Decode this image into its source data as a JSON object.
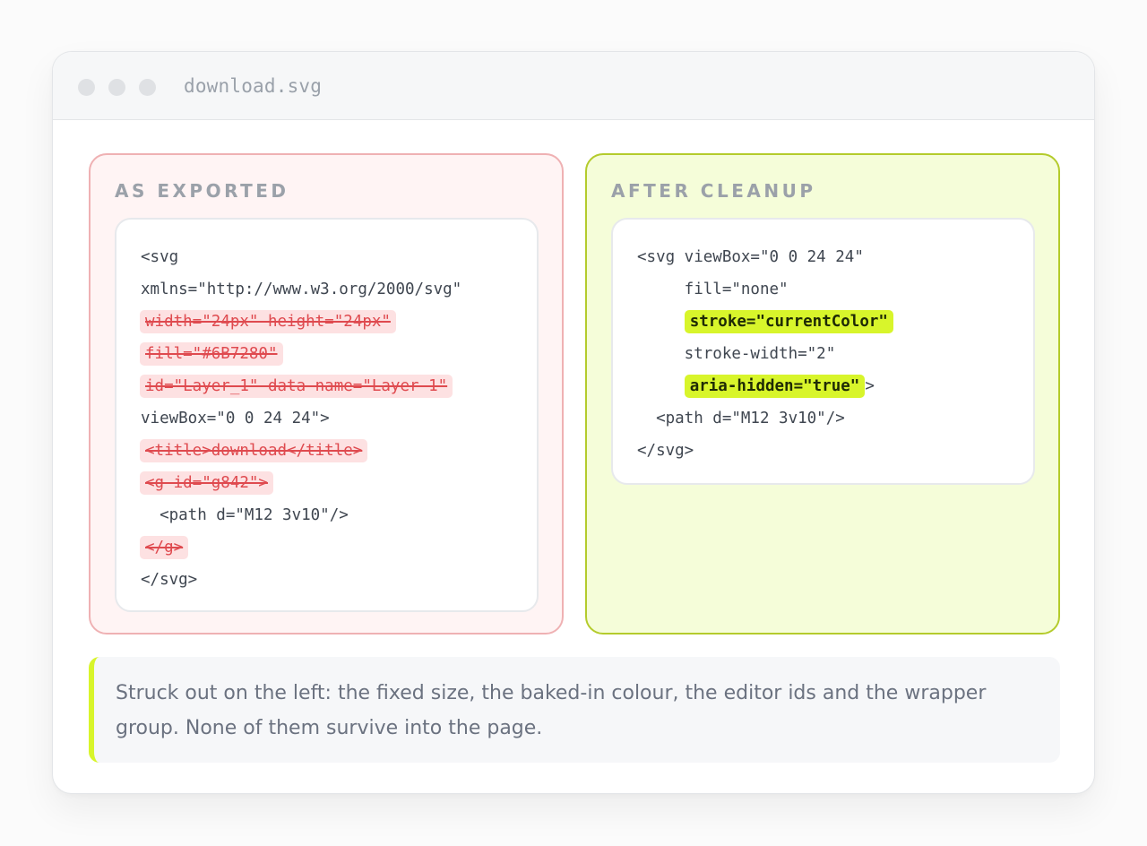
{
  "window": {
    "title": "download.svg"
  },
  "left_panel": {
    "label": "AS EXPORTED",
    "lines": [
      {
        "text": "<svg"
      },
      {
        "text": "xmlns=\"http://www.w3.org/2000/svg\""
      },
      {
        "text": "width=\"24px\" height=\"24px\""
      },
      {
        "text": "fill=\"#6B7280\""
      },
      {
        "text": "id=\"Layer_1\" data-name=\"Layer 1\""
      },
      {
        "text": "viewBox=\"0 0 24 24\">"
      },
      {
        "text": "<title>download</title>"
      },
      {
        "text": "<g id=\"g842\">"
      },
      {
        "text": "  <path d=\"M12 3v10\"/>"
      },
      {
        "text": "</g>"
      },
      {
        "text": "</svg>"
      }
    ]
  },
  "right_panel": {
    "label": "AFTER CLEANUP",
    "lines": [
      {
        "text": "<svg viewBox=\"0 0 24 24\""
      },
      {
        "text": "     fill=\"none\""
      },
      {
        "indent": "     ",
        "text": "stroke=\"currentColor\""
      },
      {
        "text": "     stroke-width=\"2\""
      },
      {
        "indent": "     ",
        "text": "aria-hidden=\"true\"",
        "suffix": ">"
      },
      {
        "text": "  <path d=\"M12 3v10\"/>"
      },
      {
        "text": "</svg>"
      }
    ]
  },
  "note": {
    "text": "Struck out on the left: the fixed size, the baked-in colour, the editor ids and the wrapper group. None of them survive into the page."
  },
  "colors": {
    "removed": "#df4a4f",
    "removed_bg": "#fde1e2",
    "added_bg": "#d8f52b",
    "left_border": "#efb1b3",
    "right_border": "#b4cb2c"
  }
}
